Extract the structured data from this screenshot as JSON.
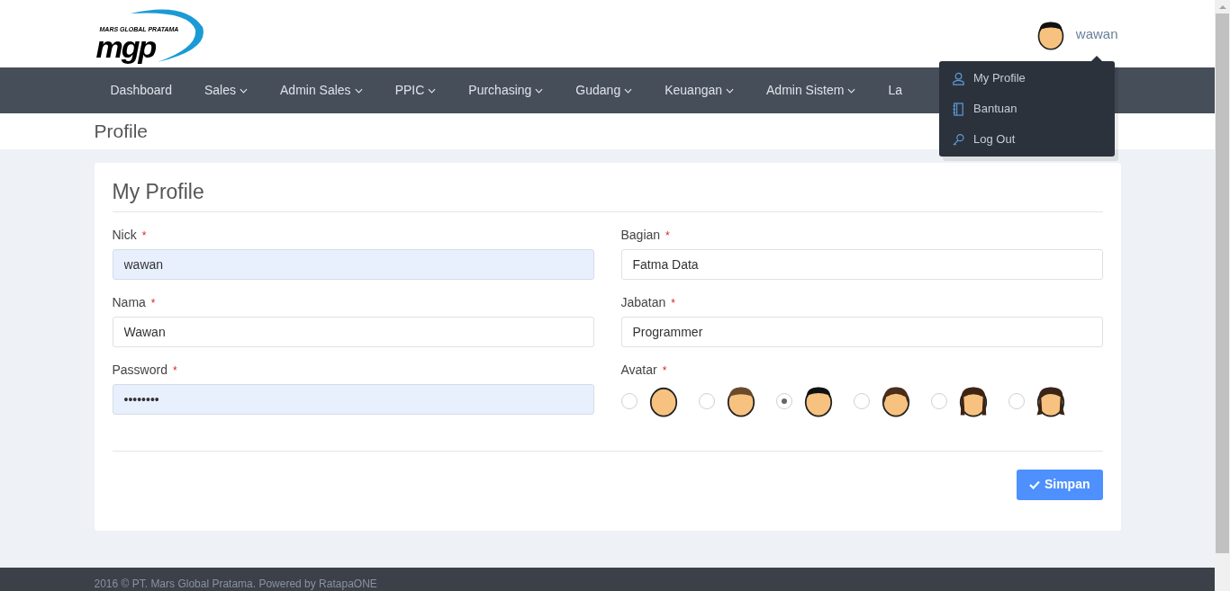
{
  "logo": {
    "tagline": "MARS GLOBAL PRATAMA",
    "mark": "mgp"
  },
  "user": {
    "name": "wawan"
  },
  "nav": [
    {
      "label": "Dashboard",
      "dropdown": false
    },
    {
      "label": "Sales",
      "dropdown": true
    },
    {
      "label": "Admin Sales",
      "dropdown": true
    },
    {
      "label": "PPIC",
      "dropdown": true
    },
    {
      "label": "Purchasing",
      "dropdown": true
    },
    {
      "label": "Gudang",
      "dropdown": true
    },
    {
      "label": "Keuangan",
      "dropdown": true
    },
    {
      "label": "Admin Sistem",
      "dropdown": true
    },
    {
      "label": "La",
      "dropdown": false
    }
  ],
  "user_menu": [
    {
      "label": "My Profile",
      "kind": "user"
    },
    {
      "label": "Bantuan",
      "kind": "book"
    },
    {
      "label": "Log Out",
      "kind": "key"
    }
  ],
  "page_title": "Profile",
  "card": {
    "title": "My Profile",
    "left_fields": [
      {
        "label": "Nick",
        "required_mark": "*",
        "value": "wawan",
        "autofilled": true
      },
      {
        "label": "Nama",
        "required_mark": "*",
        "value": "Wawan",
        "autofilled": false
      },
      {
        "label": "Password",
        "required_mark": "*",
        "value": "••••••••",
        "autofilled": true
      }
    ],
    "right_fields": [
      {
        "label": "Bagian",
        "required_mark": "*",
        "value": "Fatma Data",
        "autofilled": false
      },
      {
        "label": "Jabatan",
        "required_mark": "*",
        "value": "Programmer",
        "autofilled": false
      }
    ],
    "avatar_field": {
      "label": "Avatar",
      "required_mark": "*",
      "options": [
        {
          "selected": false,
          "kind": "bald"
        },
        {
          "selected": false,
          "kind": "brown"
        },
        {
          "selected": true,
          "kind": "black"
        },
        {
          "selected": false,
          "kind": "bob"
        },
        {
          "selected": false,
          "kind": "long"
        },
        {
          "selected": false,
          "kind": "wavy"
        }
      ]
    },
    "save_button": "Simpan"
  },
  "footer": "2016 © PT. Mars Global Pratama. Powered by RatapaONE"
}
